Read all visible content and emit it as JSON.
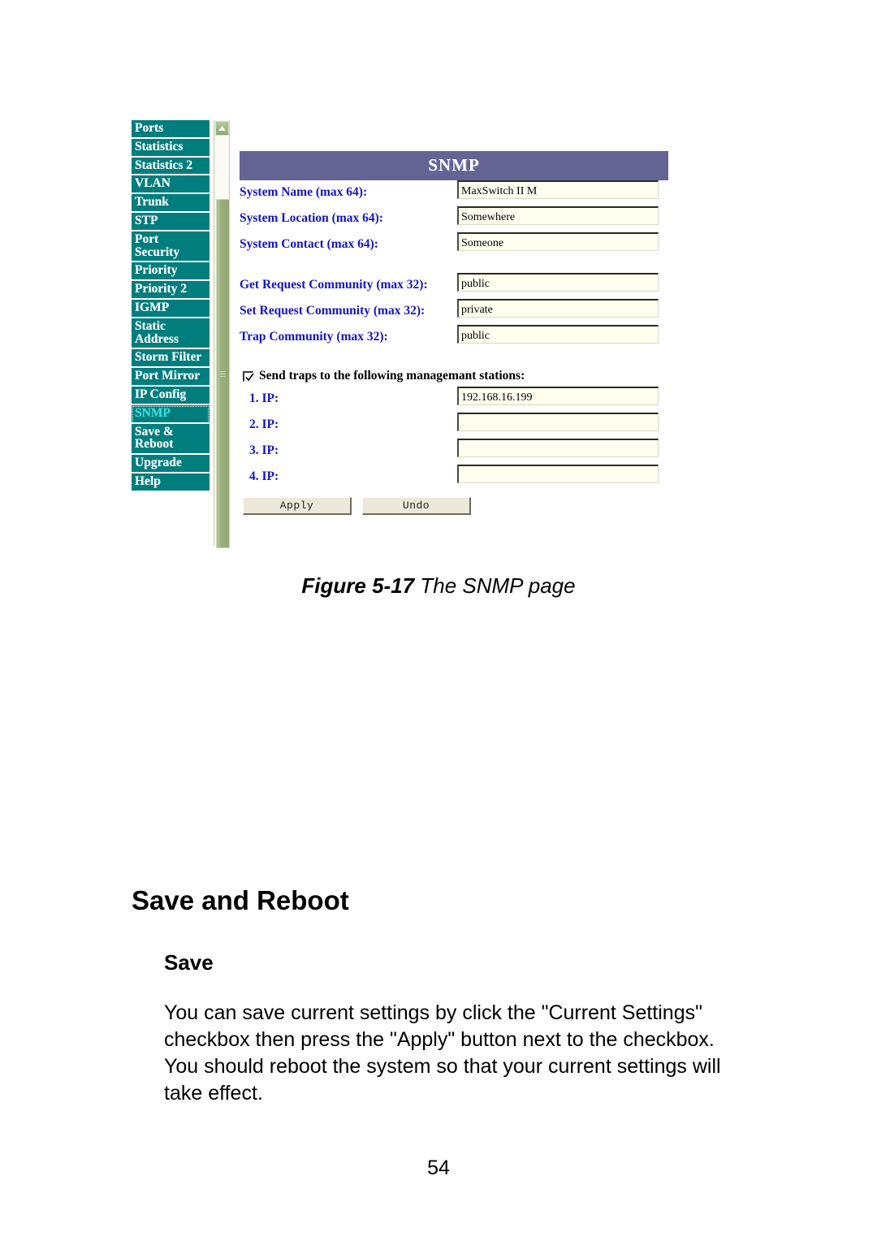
{
  "figure": {
    "nav": {
      "items": [
        {
          "label": "Ports",
          "selected": false,
          "lines": 1
        },
        {
          "label": "Statistics",
          "selected": false,
          "lines": 1
        },
        {
          "label": "Statistics 2",
          "selected": false,
          "lines": 1
        },
        {
          "label": "VLAN",
          "selected": false,
          "lines": 1
        },
        {
          "label": "Trunk",
          "selected": false,
          "lines": 1
        },
        {
          "label": "STP",
          "selected": false,
          "lines": 1
        },
        {
          "label": "Port\nSecurity",
          "selected": false,
          "lines": 2
        },
        {
          "label": "Priority",
          "selected": false,
          "lines": 1
        },
        {
          "label": "Priority 2",
          "selected": false,
          "lines": 1
        },
        {
          "label": "IGMP",
          "selected": false,
          "lines": 1
        },
        {
          "label": "Static\nAddress",
          "selected": false,
          "lines": 2
        },
        {
          "label": "Storm Filter",
          "selected": false,
          "lines": 1
        },
        {
          "label": "Port Mirror",
          "selected": false,
          "lines": 1
        },
        {
          "label": "IP Config",
          "selected": false,
          "lines": 1
        },
        {
          "label": "SNMP",
          "selected": true,
          "lines": 1
        },
        {
          "label": "Save &\nReboot",
          "selected": false,
          "lines": 2
        },
        {
          "label": "Upgrade",
          "selected": false,
          "lines": 1
        },
        {
          "label": "Help",
          "selected": false,
          "lines": 1
        }
      ],
      "colors": {
        "item_background": "#007d7d",
        "item_text": "#ffffff",
        "selected_text": "#27dede",
        "scrollbar_thumb": "#9aae7c"
      }
    },
    "panel": {
      "title": "SNMP",
      "title_bar_color": "#636394",
      "label_color": "#1515c4",
      "fields": [
        {
          "label": "System Name (max 64):",
          "value": "MaxSwitch II M"
        },
        {
          "label": "System Location (max 64):",
          "value": "Somewhere"
        },
        {
          "label": "System Contact (max 64):",
          "value": "Someone"
        }
      ],
      "community_fields": [
        {
          "label": "Get Request Community (max 32):",
          "value": "public"
        },
        {
          "label": "Set Request Community (max 32):",
          "value": "private"
        },
        {
          "label": "Trap Community (max 32):",
          "value": "public"
        }
      ],
      "traps": {
        "checkbox_label": "Send traps to the following managemant stations:",
        "checked": true,
        "ip_rows": [
          {
            "label": "1. IP:",
            "value": "192.168.16.199"
          },
          {
            "label": "2. IP:",
            "value": ""
          },
          {
            "label": "3. IP:",
            "value": ""
          },
          {
            "label": "4. IP:",
            "value": ""
          }
        ]
      },
      "buttons": {
        "apply": "Apply",
        "undo": "Undo"
      }
    }
  },
  "document": {
    "figure_caption_prefix": "Figure 5-17",
    "figure_caption_rest": " The SNMP page",
    "heading_main": "Save and Reboot",
    "heading_sub": "Save",
    "paragraph": "You can save current settings by click the \"Current Settings\" checkbox then press the \"Apply\" button next to the checkbox. You should reboot the system so that your current settings will take effect.",
    "page_number": "54"
  }
}
